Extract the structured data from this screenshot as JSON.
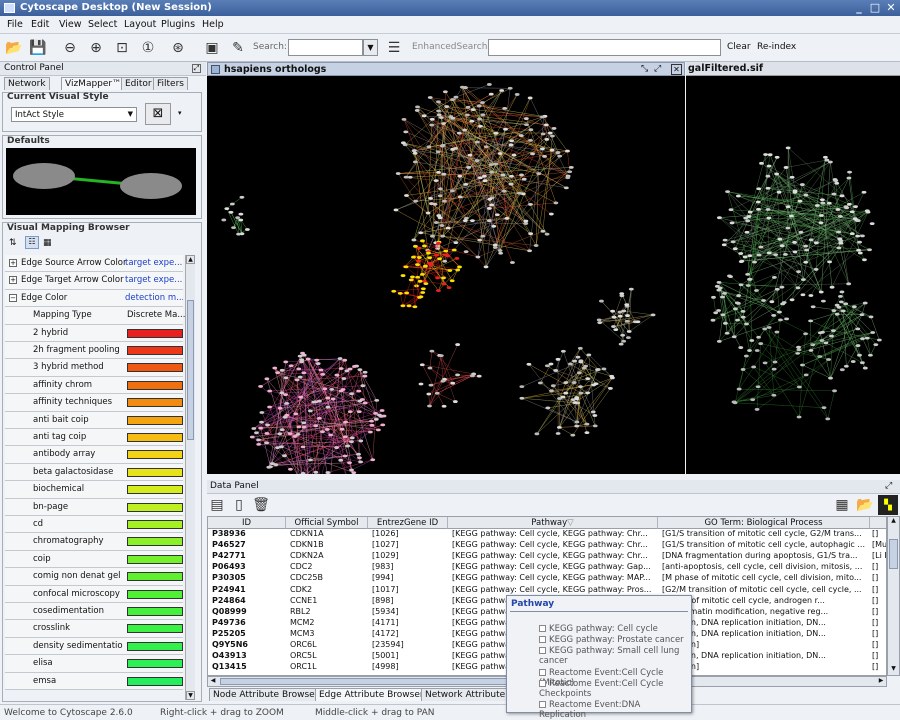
{
  "app": {
    "title": "Cytoscape Desktop (New Session)"
  },
  "menu": [
    "File",
    "Edit",
    "View",
    "Select",
    "Layout",
    "Plugins",
    "Help"
  ],
  "toolbar": {
    "search_label": "Search:",
    "enhanced_label": "EnhancedSearch:",
    "clear": "Clear",
    "reindex": "Re-index"
  },
  "control_panel": {
    "title": "Control Panel",
    "tabs": [
      "Network",
      "VizMapper™",
      "Editor",
      "Filters"
    ],
    "current_visual_style_label": "Current Visual Style",
    "visual_style_value": "IntAct Style",
    "defaults_label": "Defaults",
    "vmb_label": "Visual Mapping Browser",
    "props": [
      {
        "name": "Edge Source Arrow Color",
        "value": "target expe..."
      },
      {
        "name": "Edge Target Arrow Color",
        "value": "target expe..."
      },
      {
        "name": "Edge Color",
        "value": "detection m..."
      }
    ],
    "mapping_type_label": "Mapping Type",
    "mapping_type_value": "Discrete Ma...",
    "entries": [
      {
        "label": "2 hybrid",
        "color": "#e82020"
      },
      {
        "label": "2h fragment pooling",
        "color": "#ec3818"
      },
      {
        "label": "3 hybrid method",
        "color": "#ee5a14"
      },
      {
        "label": "affinity chrom",
        "color": "#f07010"
      },
      {
        "label": "affinity techniques",
        "color": "#f28c10"
      },
      {
        "label": "anti bait coip",
        "color": "#f4a410"
      },
      {
        "label": "anti tag coip",
        "color": "#f6bc12"
      },
      {
        "label": "antibody array",
        "color": "#f2d414"
      },
      {
        "label": "beta galactosidase",
        "color": "#e6e418"
      },
      {
        "label": "biochemical",
        "color": "#d4ec1c"
      },
      {
        "label": "bn-page",
        "color": "#bcf020"
      },
      {
        "label": "cd",
        "color": "#a4f024"
      },
      {
        "label": "chromatography",
        "color": "#8cf028"
      },
      {
        "label": "coip",
        "color": "#74f02c"
      },
      {
        "label": "comig non denat gel",
        "color": "#60f030"
      },
      {
        "label": "confocal microscopy",
        "color": "#50f034"
      },
      {
        "label": "cosedimentation",
        "color": "#44f03c"
      },
      {
        "label": "crosslink",
        "color": "#3cf044"
      },
      {
        "label": "density sedimentatio",
        "color": "#34f04c"
      },
      {
        "label": "elisa",
        "color": "#2cf054"
      },
      {
        "label": "emsa",
        "color": "#24ee5c"
      }
    ]
  },
  "network1": {
    "title": "hsapiens orthologs"
  },
  "network2": {
    "title": "galFiltered.sif"
  },
  "data_panel": {
    "title": "Data Panel",
    "columns": [
      "ID",
      "Official Symbol",
      "EntrezGene ID",
      "Pathway",
      "GO Term: Biological Process"
    ],
    "rows": [
      [
        "P38936",
        "CDKN1A",
        "[1026]",
        "[KEGG pathway: Cell cycle, KEGG pathway: Chr...",
        "[G1/S transition of mitotic cell cycle, G2/M trans...",
        "[]"
      ],
      [
        "P46527",
        "CDKN1B",
        "[1027]",
        "[KEGG pathway: Cell cycle, KEGG pathway: Chr...",
        "[G1/S transition of mitotic cell cycle, autophagic ...",
        "[Mu"
      ],
      [
        "P42771",
        "CDKN2A",
        "[1029]",
        "[KEGG pathway: Cell cycle, KEGG pathway: Chr...",
        "[DNA fragmentation during apoptosis, G1/S tra...",
        "[Li F"
      ],
      [
        "P06493",
        "CDC2",
        "[983]",
        "[KEGG pathway: Cell cycle, KEGG pathway: Gap...",
        "[anti-apoptosis, cell cycle, cell division, mitosis, ...",
        "[]"
      ],
      [
        "P30305",
        "CDC25B",
        "[994]",
        "[KEGG pathway: Cell cycle, KEGG pathway: MAP...",
        "[M phase of mitotic cell cycle, cell division, mito...",
        "[]"
      ],
      [
        "P24941",
        "CDK2",
        "[1017]",
        "[KEGG pathway: Cell cycle, KEGG pathway: Pros...",
        "[G2/M transition of mitotic cell cycle, cell cycle, ...",
        "[]"
      ],
      [
        "P24864",
        "CCNE1",
        "[898]",
        "[KEGG pathwa",
        "nsition of mitotic cell cycle, androgen r...",
        "[]"
      ],
      [
        "Q08999",
        "RBL2",
        "[5934]",
        "[KEGG pathwa",
        "e, chromatin modification, negative reg...",
        "[]"
      ],
      [
        "P49736",
        "MCM2",
        "[4171]",
        "[KEGG pathwa",
        "olication, DNA replication initiation, DN...",
        "[]"
      ],
      [
        "P25205",
        "MCM3",
        "[4172]",
        "[KEGG pathwa",
        "olication, DNA replication initiation, DN...",
        "[]"
      ],
      [
        "Q9Y5N6",
        "ORC6L",
        "[23594]",
        "[KEGG pathwa",
        "olication]",
        "[]"
      ],
      [
        "O43913",
        "ORC5L",
        "[5001]",
        "[KEGG pathwa",
        "olication, DNA replication initiation, DN...",
        "[]"
      ],
      [
        "Q13415",
        "ORC1L",
        "[4998]",
        "[KEGG pathwa",
        "olication]",
        "[]"
      ]
    ],
    "bottom_tabs": [
      "Node Attribute Browser",
      "Edge Attribute Browser",
      "Network Attribute B"
    ]
  },
  "popup": {
    "title": "Pathway",
    "items": [
      "KEGG pathway: Cell cycle",
      "KEGG pathway: Prostate cancer",
      "KEGG pathway: Small cell lung cancer",
      "Reactome Event:Cell Cycle (Mitotic)",
      "Reactome Event:Cell Cycle Checkpoints",
      "Reactome Event:DNA Replication"
    ]
  },
  "status": {
    "left": "Welcome to Cytoscape 2.6.0",
    "zoom": "Right-click + drag  to  ZOOM",
    "pan": "Middle-click + drag  to  PAN"
  }
}
